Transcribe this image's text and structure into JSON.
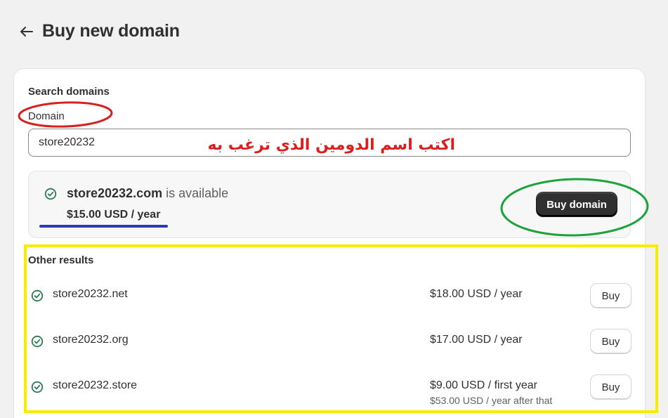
{
  "header": {
    "title": "Buy new domain",
    "back_icon": "arrow-left-icon"
  },
  "search": {
    "section_title": "Search domains",
    "field_label": "Domain",
    "value": "store20232"
  },
  "annotation": {
    "text": "اكتب اسم الدومين الذي ترغب به",
    "color": "#d9201f"
  },
  "available": {
    "domain": "store20232.com",
    "status": " is available",
    "price": "$15.00 USD / year",
    "button_label": "Buy domain",
    "icon": "check-circle-icon"
  },
  "other_results": {
    "title": "Other results",
    "items": [
      {
        "domain": "store20232.net",
        "price": "$18.00 USD / year",
        "sub": "",
        "button_label": "Buy"
      },
      {
        "domain": "store20232.org",
        "price": "$17.00 USD / year",
        "sub": "",
        "button_label": "Buy"
      },
      {
        "domain": "store20232.store",
        "price": "$9.00 USD / first year",
        "sub": "$53.00 USD / year after that",
        "button_label": "Buy"
      }
    ]
  },
  "colors": {
    "accent_green": "#2f7a52",
    "highlight_red": "#d9201f",
    "highlight_green": "#1aa33a",
    "highlight_yellow": "#f5ec00",
    "highlight_blue": "#2c3cb8"
  }
}
